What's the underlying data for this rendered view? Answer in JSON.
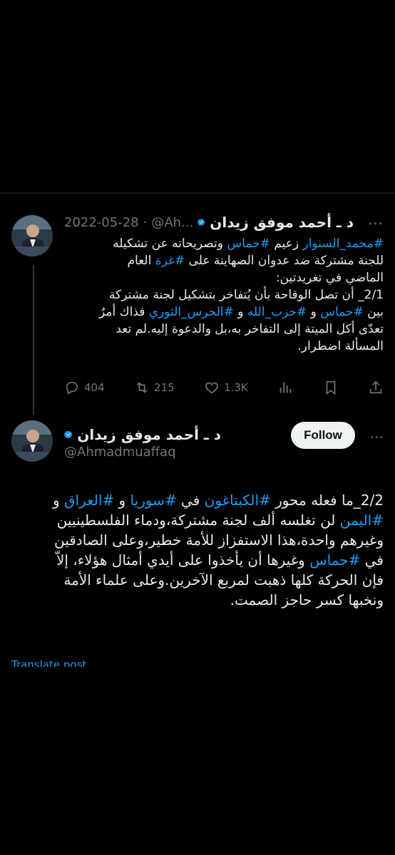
{
  "tweet1": {
    "author_name": "د ـ أحمد موفق زيدان",
    "handle": "@Ah...",
    "dot": "·",
    "date": "2022-05-28",
    "more": "···",
    "lines": [
      "#محمد_السنوار زعيم #حماس وتصريحاته عن تشكيله",
      "للجنة مشتركة ضد عدوان الصهاينة على #غزة العام",
      "الماضي في تغريدتين:",
      "2/1_ أن تصل الوقاحة بأن يُتفاخر بتشكيل لجنة مشتركة",
      "بين #حماس و #حزب_الله و #الحرس_الثوري فذاك أمرٌ",
      "تعدّى أكل الميتة إلى التفاخر به،بل والدعوة إليه.لم تعد",
      "المسألة اضطرار."
    ],
    "actions": {
      "replies": "404",
      "retweets": "215",
      "likes": "1.3K"
    }
  },
  "tweet2": {
    "author_name": "د ـ أحمد موفق زيدان",
    "handle": "@Ahmadmuaffaq",
    "follow_label": "Follow",
    "more": "···",
    "lines": [
      "2/2_ما فعله محور #الكبتاغون في #سوريا و #العراق و",
      "#اليمن لن تغلسه ألف لجنة مشتركة،ودماء الفلسطينيين",
      "وغيرهم واحدة،هذا الاستفزاز للأمة خطير،وعلى الصادقين",
      "في #حماس وغيرها أن يأخذوا على أيدي أمثال هؤلاء، إلاّ",
      "فإن الحركة كلها ذهبت لمربع الآخرين.وعلى علماء الأمة",
      "ونخبها كسر حاجز الصمت."
    ],
    "translate": "Translate post"
  },
  "colors": {
    "background": "#000000",
    "text": "#e7e9ea",
    "muted": "#71767b",
    "accent": "#1d9bf0",
    "follow_bg": "#eff3f4"
  },
  "icons": [
    "verified-badge-icon",
    "reply-icon",
    "retweet-icon",
    "like-icon",
    "views-icon",
    "bookmark-icon",
    "share-icon",
    "more-icon"
  ]
}
